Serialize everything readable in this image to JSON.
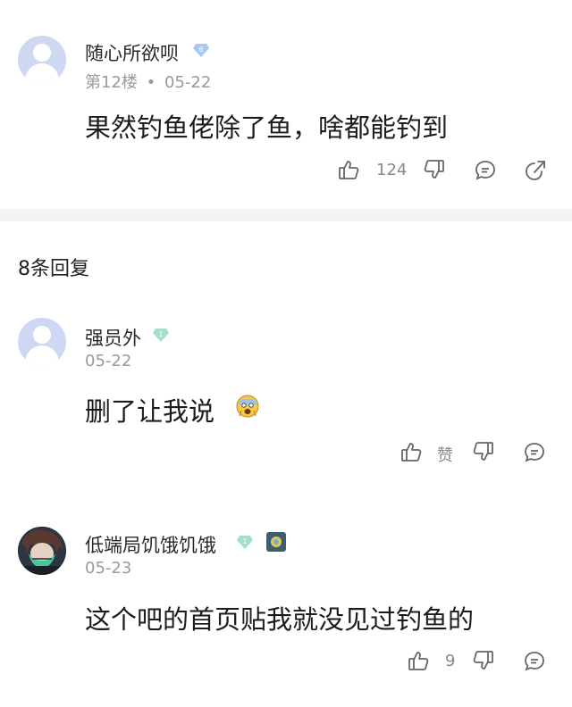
{
  "post": {
    "username": "随心所欲呗",
    "level": "6",
    "floor": "第12楼",
    "dot": "•",
    "date": "05-22",
    "content": "果然钓鱼佬除了鱼，啥都能钓到",
    "like_count": "124"
  },
  "replies_header": "8条回复",
  "replies": [
    {
      "username": "强员外",
      "level": "1",
      "date": "05-22",
      "content": "删了让我说",
      "like_label": "赞"
    },
    {
      "username": "低端局饥饿饥饿",
      "level": "1",
      "date": "05-23",
      "content": "这个吧的首页贴我就没见过钓鱼的",
      "like_count": "9"
    }
  ],
  "colors": {
    "badge_blue": "#a8c8f4",
    "badge_green": "#a4e0c8",
    "divider": "#f3f3f3",
    "meta_gray": "#9a9a9a"
  },
  "icons": [
    "thumbs-up-icon",
    "thumbs-down-icon",
    "comment-icon",
    "share-icon",
    "level-badge-icon",
    "fear-emoji-icon"
  ]
}
